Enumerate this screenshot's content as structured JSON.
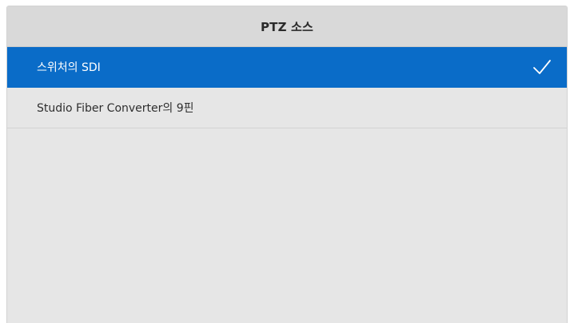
{
  "header": {
    "title": "PTZ 소스"
  },
  "list": {
    "items": [
      {
        "label": "스위처의 SDI",
        "selected": true
      },
      {
        "label": "Studio Fiber Converter의 9핀",
        "selected": false
      }
    ]
  },
  "icons": {
    "selected_indicator": "checkmark-icon"
  },
  "colors": {
    "selected_background": "#0a6cc8",
    "selected_text": "#ffffff",
    "panel_background": "#e6e6e6",
    "header_background": "#d9d9d9",
    "text": "#2e2e2e"
  }
}
